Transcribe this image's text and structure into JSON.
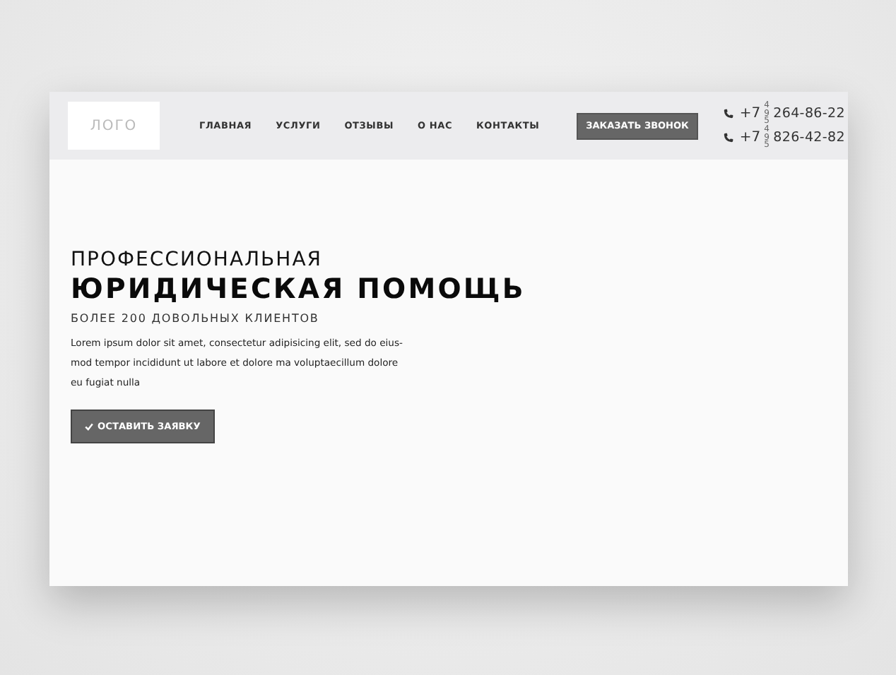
{
  "header": {
    "logo": "ЛОГО",
    "nav": [
      {
        "label": "ГЛАВНАЯ"
      },
      {
        "label": "УСЛУГИ"
      },
      {
        "label": "ОТЗЫВЫ"
      },
      {
        "label": "О НАС"
      },
      {
        "label": "КОНТАКТЫ"
      }
    ],
    "call_button": "ЗАКАЗАТЬ ЗВОНОК",
    "phones": [
      {
        "prefix": "+7",
        "code": "495",
        "number": "264-86-22"
      },
      {
        "prefix": "+7",
        "code": "495",
        "number": "826-42-82"
      }
    ]
  },
  "hero": {
    "title_line_1": "ПРОФЕССИОНАЛЬНАЯ",
    "title_line_2": "ЮРИДИЧЕСКАЯ ПОМОЩЬ",
    "subtitle": "БОЛЕЕ 200 ДОВОЛЬНЫХ КЛИЕНТОВ",
    "text": "Lorem ipsum dolor sit amet, consectetur adipisicing elit, sed do eius-mod tempor incididunt ut labore et dolore ma voluptaecillum dolore eu fugiat nulla",
    "button": "ОСТАВИТЬ ЗАЯВКУ"
  }
}
